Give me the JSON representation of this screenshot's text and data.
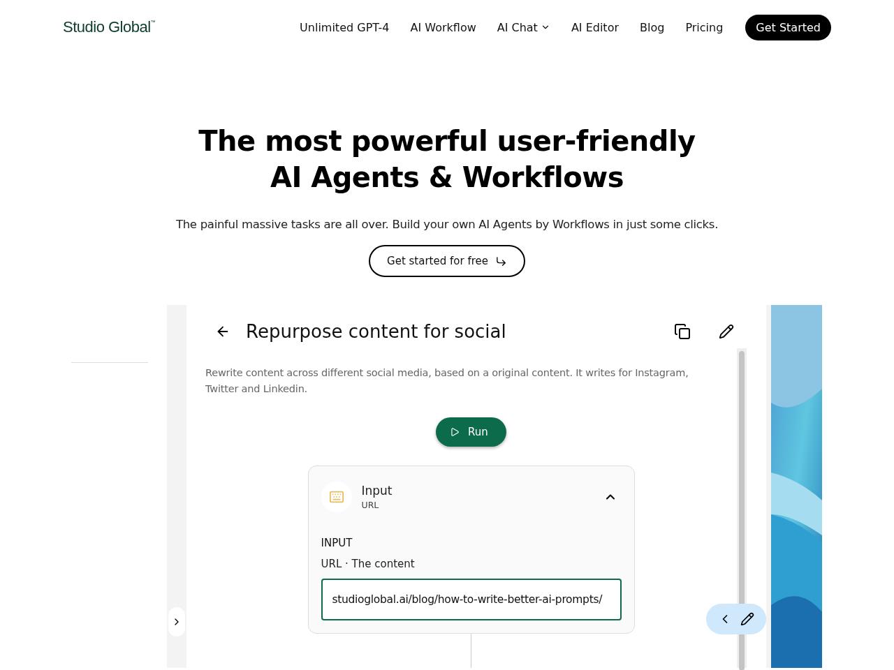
{
  "nav": {
    "logo": "Studio Global",
    "logo_mark": "™",
    "links": [
      {
        "label": "Unlimited GPT-4",
        "kind": "link"
      },
      {
        "label": "AI Workflow",
        "kind": "link"
      },
      {
        "label": "AI Chat",
        "kind": "dropdown"
      },
      {
        "label": "AI Editor",
        "kind": "link"
      },
      {
        "label": "Blog",
        "kind": "link"
      },
      {
        "label": "Pricing",
        "kind": "link"
      }
    ],
    "cta": "Get Started"
  },
  "hero": {
    "title_lines": [
      "The most powerful user-friendly",
      "AI Agents & Workflows"
    ],
    "subtitle": "The painful massive tasks are all over. Build your own AI Agents by Workflows in just some clicks.",
    "button": "Get started for free"
  },
  "demo": {
    "title": "Repurpose content for social",
    "description": "Rewrite content across different social media, based on a original content. It writes for Instagram, Twitter and Linkedin.",
    "run_button": "Run",
    "card": {
      "title": "Input",
      "subtitle": "URL",
      "expanded": true,
      "section": "INPUT",
      "field_label": "URL · The content",
      "value": "studioglobal.ai/blog/how-to-write-better-ai-prompts/"
    }
  }
}
